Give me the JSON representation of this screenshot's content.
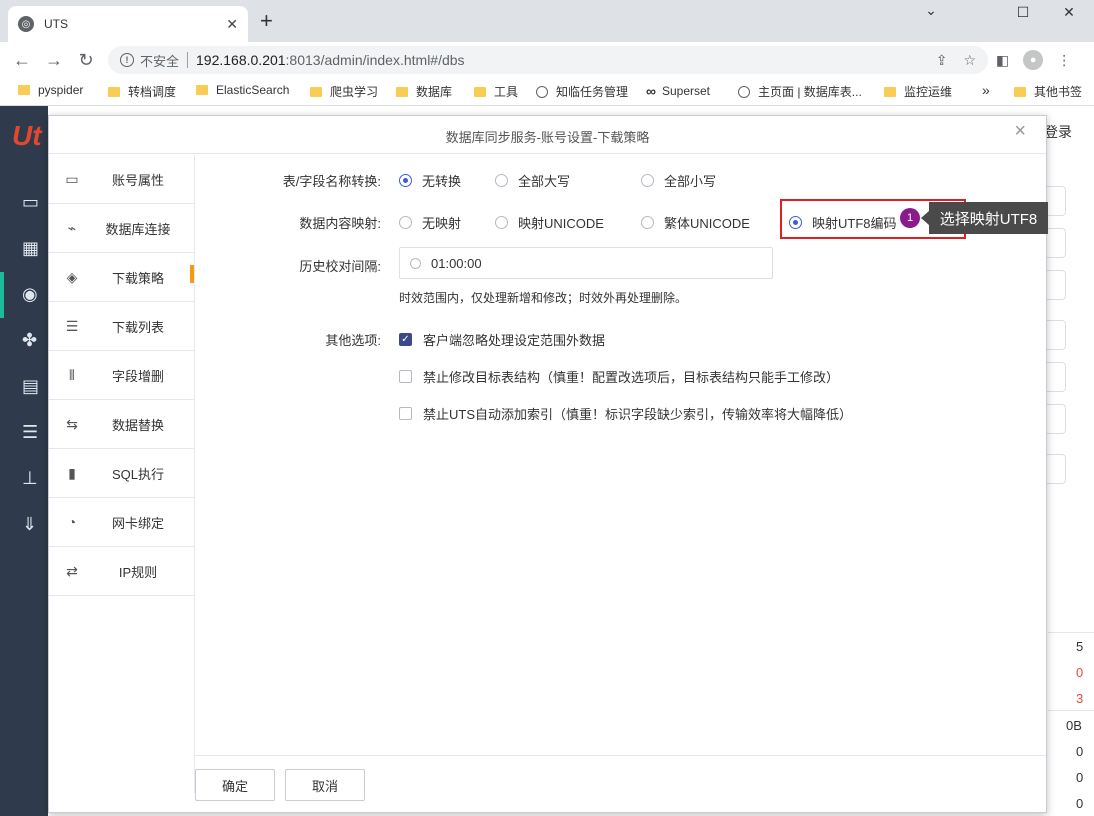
{
  "browser": {
    "tab_title": "UTS",
    "tab_close": "✕",
    "new_tab": "+",
    "win_min": "⌄",
    "win_max": "☐",
    "win_close": "✕",
    "back": "←",
    "forward": "→",
    "reload": "↻",
    "insecure_label": "不安全",
    "url_host": "192.168.0.201",
    "url_rest": ":8013/admin/index.html#/dbs",
    "share": "⇪",
    "star": "☆",
    "sidepanel": "◧",
    "menu": "⋮",
    "bookmarks": [
      "pyspider",
      "转档调度",
      "ElasticSearch",
      "爬虫学习",
      "数据库",
      "工具",
      "知临任务管理",
      "Superset",
      "主页面 | 数据库表...",
      "监控运维"
    ],
    "bookmark_more": "»",
    "bookmark_other": "其他书签"
  },
  "app": {
    "logo": "Ut",
    "login": "登录",
    "right_numbers": [
      "5",
      "0",
      "3",
      "0B",
      "0",
      "0",
      "0"
    ]
  },
  "modal": {
    "title": "数据库同步服务-账号设置-下载策略",
    "close": "×",
    "menu": [
      {
        "label": "账号属性",
        "icon": "▭"
      },
      {
        "label": "数据库连接",
        "icon": "⌁"
      },
      {
        "label": "下载策略",
        "icon": "◈"
      },
      {
        "label": "下载列表",
        "icon": "☰"
      },
      {
        "label": "字段增删",
        "icon": "⫴"
      },
      {
        "label": "数据替换",
        "icon": "⇆"
      },
      {
        "label": "SQL执行",
        "icon": "▮"
      },
      {
        "label": "网卡绑定",
        "icon": "◔"
      },
      {
        "label": "IP规则",
        "icon": "⇄"
      }
    ],
    "form": {
      "name_convert_label": "表/字段名称转换:",
      "name_convert_options": [
        "无转换",
        "全部大写",
        "全部小写"
      ],
      "content_map_label": "数据内容映射:",
      "content_map_options": [
        "无映射",
        "映射UNICODE",
        "繁体UNICODE",
        "映射UTF8编码"
      ],
      "history_label": "历史校对间隔:",
      "history_value": "01:00:00",
      "history_help": "时效范围内，仅处理新增和修改；时效外再处理删除。",
      "other_label": "其他选项:",
      "other_options": [
        "客户端忽略处理设定范围外数据",
        "禁止修改目标表结构（慎重！配置改选项后，目标表结构只能手工修改）",
        "禁止UTS自动添加索引（慎重！标识字段缺少索引，传输效率将大幅降低）"
      ]
    },
    "annotation": {
      "step": "1",
      "tooltip": "选择映射UTF8"
    },
    "ok_label": "确定",
    "cancel_label": "取消"
  }
}
